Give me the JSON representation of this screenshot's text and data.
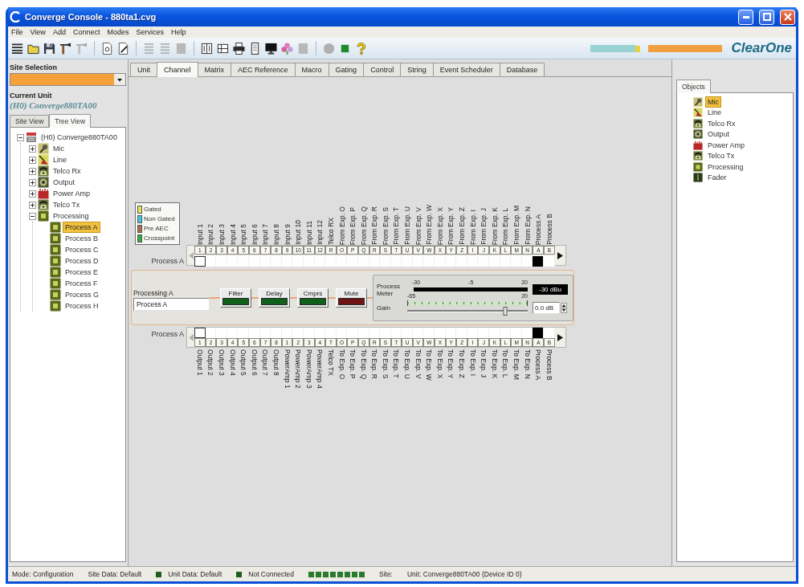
{
  "window": {
    "title": "Converge Console - 880ta1.cvg"
  },
  "menu": [
    "File",
    "View",
    "Add",
    "Connect",
    "Modes",
    "Services",
    "Help"
  ],
  "toolbar": [
    {
      "kind": "list",
      "disabled": false
    },
    {
      "kind": "folder",
      "disabled": false
    },
    {
      "kind": "save",
      "disabled": false
    },
    {
      "kind": "tool",
      "disabled": false
    },
    {
      "kind": "tool",
      "disabled": true
    },
    {
      "kind": "separator"
    },
    {
      "kind": "document",
      "disabled": false
    },
    {
      "kind": "edit",
      "disabled": false
    },
    {
      "kind": "separator"
    },
    {
      "kind": "align",
      "disabled": true
    },
    {
      "kind": "align",
      "disabled": true
    },
    {
      "kind": "panel",
      "disabled": true
    },
    {
      "kind": "separator"
    },
    {
      "kind": "book",
      "disabled": false
    },
    {
      "kind": "table",
      "disabled": false
    },
    {
      "kind": "printer",
      "disabled": false
    },
    {
      "kind": "page",
      "disabled": false
    },
    {
      "kind": "monitor",
      "disabled": false
    },
    {
      "kind": "flower",
      "disabled": false
    },
    {
      "kind": "panel",
      "disabled": true
    },
    {
      "kind": "separator"
    },
    {
      "kind": "circle",
      "disabled": true
    },
    {
      "kind": "led",
      "disabled": false
    },
    {
      "kind": "help",
      "disabled": false
    }
  ],
  "brand": "ClearOne",
  "site_selection": {
    "label": "Site Selection"
  },
  "current_unit": {
    "label": "Current Unit",
    "value": "(H0) Converge880TA00"
  },
  "view_tabs": [
    {
      "label": "Site View",
      "selected": false
    },
    {
      "label": "Tree View",
      "selected": true
    }
  ],
  "tree": {
    "label": "(H0) Converge880TA00",
    "kind": "unit",
    "expanded": true,
    "selected": false,
    "children": [
      {
        "label": "Mic",
        "kind": "mic",
        "expanded": false,
        "selected": false
      },
      {
        "label": "Line",
        "kind": "line",
        "expanded": false,
        "selected": false
      },
      {
        "label": "Telco Rx",
        "kind": "telco_rx",
        "expanded": false,
        "selected": false
      },
      {
        "label": "Output",
        "kind": "output",
        "expanded": false,
        "selected": false
      },
      {
        "label": "Power Amp",
        "kind": "power_amp",
        "expanded": false,
        "selected": false
      },
      {
        "label": "Telco Tx",
        "kind": "telco_tx",
        "expanded": false,
        "selected": false
      },
      {
        "label": "Processing",
        "kind": "processing",
        "expanded": true,
        "selected": false,
        "children": [
          {
            "label": "Process A",
            "kind": "process",
            "selected": true
          },
          {
            "label": "Process B",
            "kind": "process",
            "selected": false
          },
          {
            "label": "Process C",
            "kind": "process",
            "selected": false
          },
          {
            "label": "Process D",
            "kind": "process",
            "selected": false
          },
          {
            "label": "Process E",
            "kind": "process",
            "selected": false
          },
          {
            "label": "Process F",
            "kind": "process",
            "selected": false
          },
          {
            "label": "Process G",
            "kind": "process",
            "selected": false
          },
          {
            "label": "Process H",
            "kind": "process",
            "selected": false
          }
        ]
      }
    ]
  },
  "tabs": [
    {
      "label": "Unit",
      "selected": false
    },
    {
      "label": "Channel",
      "selected": true
    },
    {
      "label": "Matrix",
      "selected": false
    },
    {
      "label": "AEC Reference",
      "selected": false
    },
    {
      "label": "Macro",
      "selected": false
    },
    {
      "label": "Gating",
      "selected": false
    },
    {
      "label": "Control",
      "selected": false
    },
    {
      "label": "String",
      "selected": false
    },
    {
      "label": "Event Scheduler",
      "selected": false
    },
    {
      "label": "Database",
      "selected": false
    }
  ],
  "legend": [
    {
      "label": "Gated",
      "color": "#e6e25a"
    },
    {
      "label": "Non Gated",
      "color": "#3ec6dc"
    },
    {
      "label": "Pre AEC",
      "color": "#a8704a"
    },
    {
      "label": "Crosspoint",
      "color": "#2eb03a"
    }
  ],
  "input_matrix": {
    "row_label": "Process A",
    "can_scroll_left": false,
    "can_scroll_right": true,
    "columns": [
      {
        "label": "Input 1",
        "button": "1",
        "routed": false,
        "focused": true
      },
      {
        "label": "Input 2",
        "button": "2",
        "routed": false,
        "focused": false
      },
      {
        "label": "Input 3",
        "button": "3",
        "routed": false,
        "focused": false
      },
      {
        "label": "Input 4",
        "button": "4",
        "routed": false,
        "focused": false
      },
      {
        "label": "Input 5",
        "button": "5",
        "routed": false,
        "focused": false
      },
      {
        "label": "Input 6",
        "button": "6",
        "routed": false,
        "focused": false
      },
      {
        "label": "Input 7",
        "button": "7",
        "routed": false,
        "focused": false
      },
      {
        "label": "Input 8",
        "button": "8",
        "routed": false,
        "focused": false
      },
      {
        "label": "Input 9",
        "button": "9",
        "routed": false,
        "focused": false
      },
      {
        "label": "Input 10",
        "button": "10",
        "routed": false,
        "focused": false
      },
      {
        "label": "Input 11",
        "button": "11",
        "routed": false,
        "focused": false
      },
      {
        "label": "Input 12",
        "button": "12",
        "routed": false,
        "focused": false
      },
      {
        "label": "Telco RX",
        "button": "R",
        "routed": false,
        "focused": false
      },
      {
        "label": "From Exp. O",
        "button": "O",
        "routed": false,
        "focused": false
      },
      {
        "label": "From Exp. P",
        "button": "P",
        "routed": false,
        "focused": false
      },
      {
        "label": "From Exp. Q",
        "button": "Q",
        "routed": false,
        "focused": false
      },
      {
        "label": "From Exp. R",
        "button": "R",
        "routed": false,
        "focused": false
      },
      {
        "label": "From Exp. S",
        "button": "S",
        "routed": false,
        "focused": false
      },
      {
        "label": "From Exp. T",
        "button": "T",
        "routed": false,
        "focused": false
      },
      {
        "label": "From Exp. U",
        "button": "U",
        "routed": false,
        "focused": false
      },
      {
        "label": "From Exp. V",
        "button": "V",
        "routed": false,
        "focused": false
      },
      {
        "label": "From Exp. W",
        "button": "W",
        "routed": false,
        "focused": false
      },
      {
        "label": "From Exp. X",
        "button": "X",
        "routed": false,
        "focused": false
      },
      {
        "label": "From Exp. Y",
        "button": "Y",
        "routed": false,
        "focused": false
      },
      {
        "label": "From Exp. Z",
        "button": "Z",
        "routed": false,
        "focused": false
      },
      {
        "label": "From Exp. I",
        "button": "I",
        "routed": false,
        "focused": false
      },
      {
        "label": "From Exp. J",
        "button": "J",
        "routed": false,
        "focused": false
      },
      {
        "label": "From Exp. K",
        "button": "K",
        "routed": false,
        "focused": false
      },
      {
        "label": "From Exp. L",
        "button": "L",
        "routed": false,
        "focused": false
      },
      {
        "label": "From Exp. M",
        "button": "M",
        "routed": false,
        "focused": false
      },
      {
        "label": "From Exp. N",
        "button": "N",
        "routed": false,
        "focused": false
      },
      {
        "label": "Process A",
        "button": "A",
        "routed": true,
        "focused": false
      },
      {
        "label": "Process B",
        "button": "B",
        "routed": false,
        "focused": false
      }
    ]
  },
  "processing": {
    "label": "Processing A",
    "name": "Process A",
    "blocks": [
      {
        "label": "Filter",
        "color": "#10601c"
      },
      {
        "label": "Delay",
        "color": "#10601c"
      },
      {
        "label": "Cmprs",
        "color": "#10601c"
      },
      {
        "label": "Mute",
        "color": "#6e1414"
      }
    ],
    "meter": {
      "label": "Process Meter",
      "scale": [
        "-30",
        "-5",
        "20"
      ],
      "readout": "-30 dBu"
    },
    "gain": {
      "label": "Gain",
      "scale": [
        "-65",
        "20"
      ],
      "level": 0.81,
      "value": "0.0 dB"
    }
  },
  "output_matrix": {
    "row_label": "Process A",
    "can_scroll_left": false,
    "can_scroll_right": true,
    "columns": [
      {
        "label": "Output 1",
        "button": "1",
        "routed": false,
        "focused": true
      },
      {
        "label": "Output 2",
        "button": "2",
        "routed": false,
        "focused": false
      },
      {
        "label": "Output 3",
        "button": "3",
        "routed": false,
        "focused": false
      },
      {
        "label": "Output 4",
        "button": "4",
        "routed": false,
        "focused": false
      },
      {
        "label": "Output 5",
        "button": "5",
        "routed": false,
        "focused": false
      },
      {
        "label": "Output 6",
        "button": "6",
        "routed": false,
        "focused": false
      },
      {
        "label": "Output 7",
        "button": "7",
        "routed": false,
        "focused": false
      },
      {
        "label": "Output 8",
        "button": "8",
        "routed": false,
        "focused": false
      },
      {
        "label": "PowerAmp 1",
        "button": "1",
        "routed": false,
        "focused": false
      },
      {
        "label": "PowerAmp 2",
        "button": "2",
        "routed": false,
        "focused": false
      },
      {
        "label": "PowerAmp 3",
        "button": "3",
        "routed": false,
        "focused": false
      },
      {
        "label": "PowerAmp 4",
        "button": "4",
        "routed": false,
        "focused": false
      },
      {
        "label": "Telco TX",
        "button": "T",
        "routed": false,
        "focused": false
      },
      {
        "label": "To Exp. O",
        "button": "O",
        "routed": false,
        "focused": false
      },
      {
        "label": "To Exp. P",
        "button": "P",
        "routed": false,
        "focused": false
      },
      {
        "label": "To Exp. Q",
        "button": "Q",
        "routed": false,
        "focused": false
      },
      {
        "label": "To Exp. R",
        "button": "R",
        "routed": false,
        "focused": false
      },
      {
        "label": "To Exp. S",
        "button": "S",
        "routed": false,
        "focused": false
      },
      {
        "label": "To Exp. T",
        "button": "T",
        "routed": false,
        "focused": false
      },
      {
        "label": "To Exp. U",
        "button": "U",
        "routed": false,
        "focused": false
      },
      {
        "label": "To Exp. V",
        "button": "V",
        "routed": false,
        "focused": false
      },
      {
        "label": "To Exp. W",
        "button": "W",
        "routed": false,
        "focused": false
      },
      {
        "label": "To Exp. X",
        "button": "X",
        "routed": false,
        "focused": false
      },
      {
        "label": "To Exp. Y",
        "button": "Y",
        "routed": false,
        "focused": false
      },
      {
        "label": "To Exp. Z",
        "button": "Z",
        "routed": false,
        "focused": false
      },
      {
        "label": "To Exp. I",
        "button": "I",
        "routed": false,
        "focused": false
      },
      {
        "label": "To Exp. J",
        "button": "J",
        "routed": false,
        "focused": false
      },
      {
        "label": "To Exp. K",
        "button": "K",
        "routed": false,
        "focused": false
      },
      {
        "label": "To Exp. L",
        "button": "L",
        "routed": false,
        "focused": false
      },
      {
        "label": "To Exp. M",
        "button": "M",
        "routed": false,
        "focused": false
      },
      {
        "label": "To Exp. N",
        "button": "N",
        "routed": false,
        "focused": false
      },
      {
        "label": "Process A",
        "button": "A",
        "routed": true,
        "focused": false
      },
      {
        "label": "Process B",
        "button": "B",
        "routed": false,
        "focused": false
      }
    ]
  },
  "objects": {
    "tab": "Objects",
    "items": [
      {
        "label": "Mic",
        "kind": "mic",
        "selected": true
      },
      {
        "label": "Line",
        "kind": "line",
        "selected": false
      },
      {
        "label": "Telco Rx",
        "kind": "telco_rx",
        "selected": false
      },
      {
        "label": "Output",
        "kind": "output",
        "selected": false
      },
      {
        "label": "Power Amp",
        "kind": "power_amp",
        "selected": false
      },
      {
        "label": "Telco Tx",
        "kind": "telco_tx",
        "selected": false
      },
      {
        "label": "Processing",
        "kind": "processing",
        "selected": false
      },
      {
        "label": "Fader",
        "kind": "fader",
        "selected": false
      }
    ]
  },
  "status_bar": [
    {
      "kind": "text",
      "text": "Mode: Configuration"
    },
    {
      "kind": "text",
      "text": "Site Data: Default"
    },
    {
      "kind": "led_text",
      "color": "#1d5e20",
      "text": "Unit Data: Default"
    },
    {
      "kind": "led_text",
      "color": "#1d5e20",
      "text": "Not Connected"
    },
    {
      "kind": "leds",
      "leds": [
        {
          "color": "#2a7a2e"
        },
        {
          "color": "#2a7a2e"
        },
        {
          "color": "#2a7a2e"
        },
        {
          "color": "#2a7a2e"
        },
        {
          "color": "#2a7a2e"
        },
        {
          "color": "#2a7a2e"
        },
        {
          "color": "#2a7a2e"
        },
        {
          "color": "#2a7a2e"
        }
      ]
    },
    {
      "kind": "text",
      "text": "Site:"
    },
    {
      "kind": "text",
      "text": "Unit: Converge880TA00 (Device ID 0)"
    }
  ]
}
